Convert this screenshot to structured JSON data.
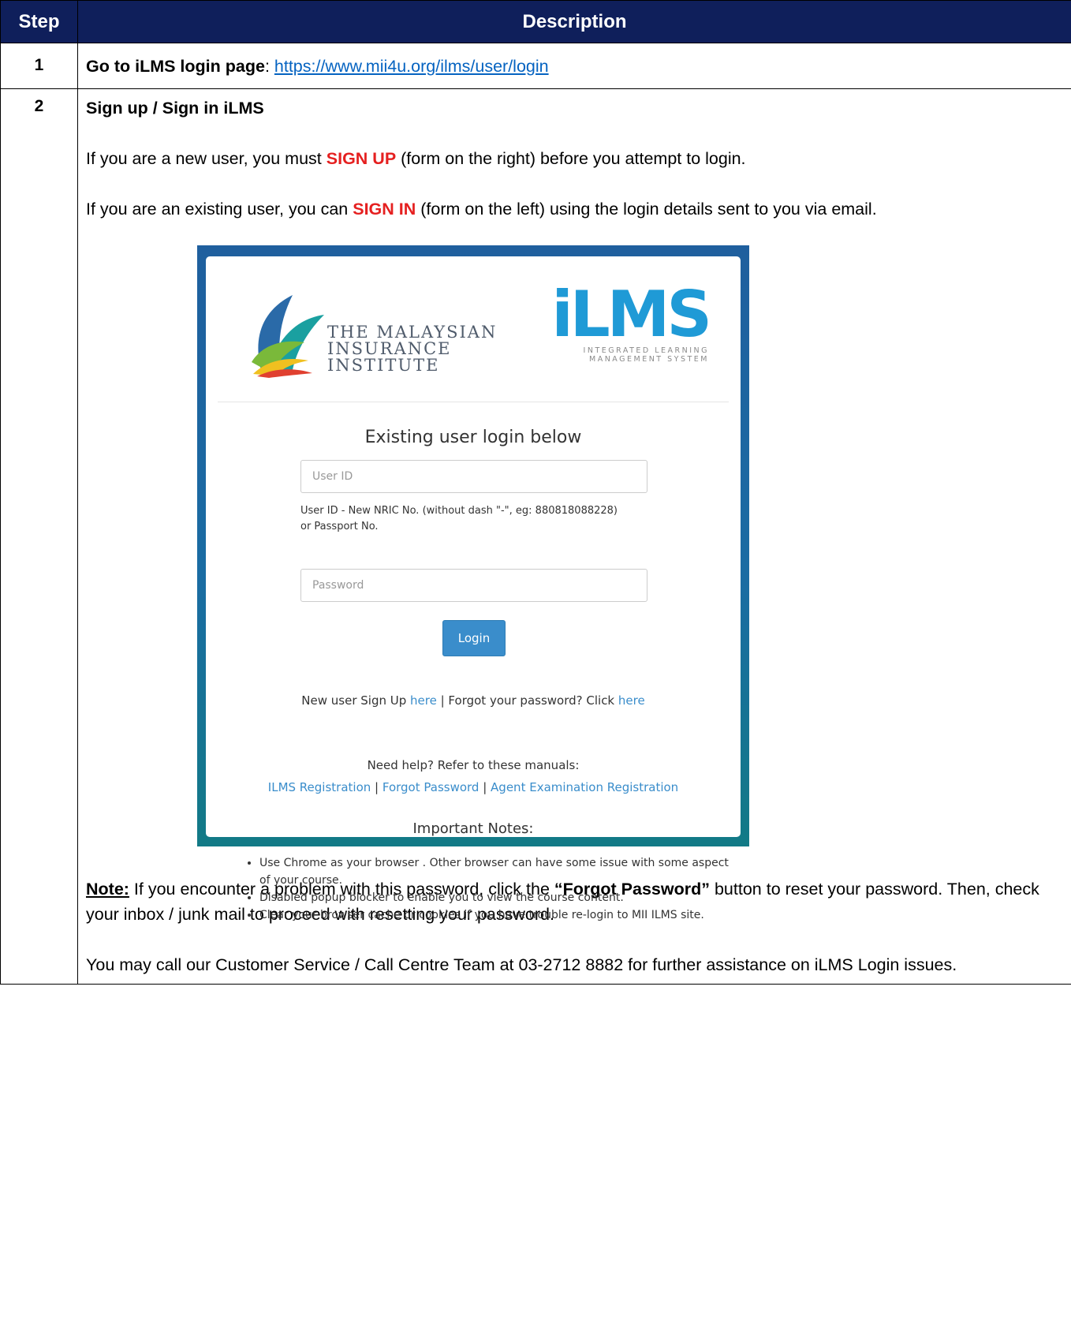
{
  "table": {
    "header_step": "Step",
    "header_description": "Description"
  },
  "step1": {
    "number": "1",
    "label": "Go to iLMS login page",
    "colon": ": ",
    "url": "https://www.mii4u.org/ilms/user/login"
  },
  "step2": {
    "number": "2",
    "title": "Sign up / Sign in iLMS",
    "p1_before": "If you are a new user, you must ",
    "p1_emph": "SIGN UP",
    "p1_after": " (form on the right) before you attempt to login.",
    "p2_before": "If you are an existing user, you can ",
    "p2_emph": "SIGN IN",
    "p2_after": " (form on the left) using the login details sent to you via email.",
    "note_label": "Note:",
    "note_before": " If you encounter a problem with this password, click the ",
    "note_emph": "“Forgot Password”",
    "note_after": " button to reset your password. Then, check your inbox / junk mail to proceed with resetting your password.",
    "call_text": "You may call our Customer Service / Call Centre Team at 03-2712 8882 for further assistance on iLMS Login issues."
  },
  "screenshot": {
    "mii_line1": "THE MALAYSIAN",
    "mii_line2": "INSURANCE INSTITUTE",
    "ilms_logo": "iLMS",
    "ilms_sub1": "INTEGRATED LEARNING",
    "ilms_sub2": "MANAGEMENT SYSTEM",
    "login_title": "Existing user login below",
    "userid_placeholder": "User ID",
    "hint_line1": "User ID - New NRIC No. (without dash \"-\", eg: 880818088228)",
    "hint_line2": "or Passport No.",
    "password_placeholder": "Password",
    "login_button": "Login",
    "signup_text": "New user Sign Up ",
    "here1": "here",
    "forgot_text": " | Forgot your password? Click ",
    "here2": "here",
    "help_text": "Need help? Refer to these manuals:",
    "manual1": "ILMS Registration",
    "sep": " | ",
    "manual2": "Forgot Password",
    "manual3": "Agent Examination Registration",
    "notes_title": "Important Notes:",
    "notes": [
      "Use Chrome as your browser . Other browser can have some issue with some aspect of your course.",
      "Disabled popup blocker to enable you to view the course content.",
      "Clear your browser cache or cookies if you have trouble re-login to MII ILMS site."
    ]
  },
  "colors": {
    "header_bg": "#0f1f5b",
    "emphasis_red": "#e52020",
    "link_blue": "#0563c1",
    "ilms_blue": "#1f9ad6"
  }
}
